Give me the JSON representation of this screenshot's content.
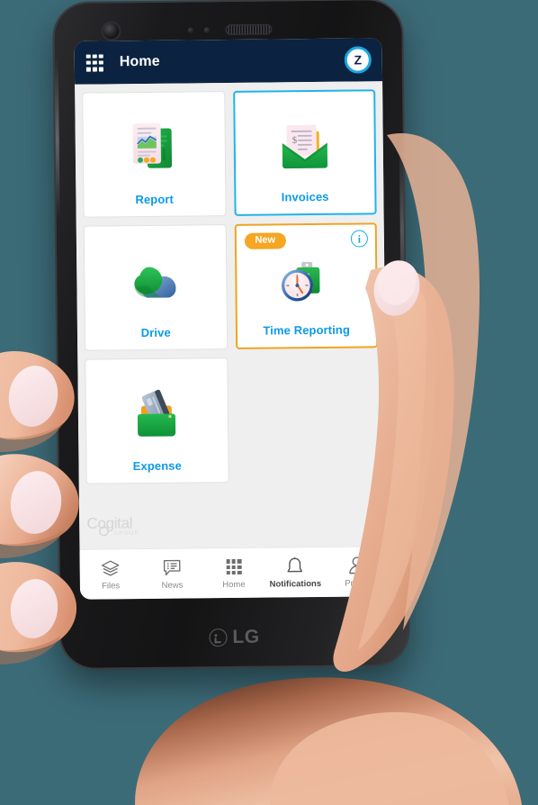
{
  "device": {
    "brand": "LG",
    "brand_mark": "lg-logo-mark",
    "camera": "front-camera",
    "speaker": "earpiece-speaker"
  },
  "header": {
    "menu_icon": "grid-menu-icon",
    "title": "Home",
    "avatar_letter": "Z",
    "avatar_ring_color": "#1ba7e0",
    "background_color": "#0b2340"
  },
  "tiles": [
    {
      "id": "report",
      "label": "Report",
      "icon": "report-document-chart-icon",
      "selected": false,
      "border_color": "#e2e2e2",
      "badge": null,
      "info": false
    },
    {
      "id": "invoices",
      "label": "Invoices",
      "icon": "invoice-envelope-icon",
      "selected": true,
      "border_color": "#22b3ea",
      "badge": null,
      "info": false
    },
    {
      "id": "drive",
      "label": "Drive",
      "icon": "cloud-drive-icon",
      "selected": false,
      "border_color": "#e2e2e2",
      "badge": null,
      "info": false
    },
    {
      "id": "time-reporting",
      "label": "Time Reporting",
      "icon": "clock-calendar-icon",
      "selected": true,
      "border_color": "#f0a423",
      "badge": "New",
      "badge_color": "#f5a623",
      "info": true,
      "info_label": "i"
    },
    {
      "id": "expense",
      "label": "Expense",
      "icon": "wallet-card-icon",
      "selected": false,
      "border_color": "#e2e2e2",
      "badge": null,
      "info": false
    }
  ],
  "tile_label_color": "#0b9ae8",
  "brand": {
    "name": "Cogital",
    "subtitle": "GROUP",
    "color": "#d4d4d4"
  },
  "bottom_nav": {
    "items": [
      {
        "id": "files",
        "label": "Files",
        "icon": "layers-icon",
        "active": false
      },
      {
        "id": "news",
        "label": "News",
        "icon": "news-bubble-icon",
        "active": false
      },
      {
        "id": "home",
        "label": "Home",
        "icon": "grid-icon",
        "active": false
      },
      {
        "id": "notifications",
        "label": "Notifications",
        "icon": "bell-icon",
        "active": true
      },
      {
        "id": "profile",
        "label": "Profile",
        "icon": "person-icon",
        "active": false
      }
    ]
  },
  "colors": {
    "background": "#3c6b78",
    "screen_bg": "#efefef",
    "tile_bg": "#ffffff",
    "accent_cyan": "#1ba7e0",
    "accent_orange": "#f5a623",
    "green": "#16a34a"
  }
}
